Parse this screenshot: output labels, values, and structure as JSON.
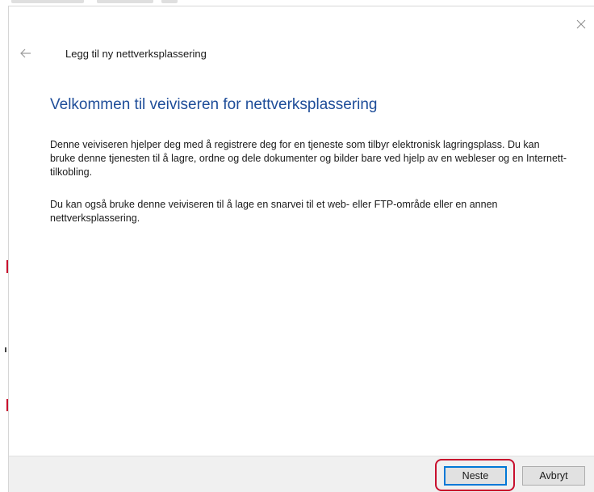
{
  "dialog": {
    "wizard_title": "Legg til ny nettverksplassering",
    "heading": "Velkommen til veiviseren for nettverksplassering",
    "paragraph1": "Denne veiviseren hjelper deg med å registrere deg for en tjeneste som tilbyr elektronisk lagringsplass. Du kan bruke denne tjenesten til å lagre, ordne og dele dokumenter og bilder bare ved hjelp av en webleser og en Internett-tilkobling.",
    "paragraph2": "Du kan også bruke denne veiviseren til å lage en snarvei til et web- eller FTP-område eller en annen nettverksplassering."
  },
  "footer": {
    "next_label": "Neste",
    "cancel_label": "Avbryt"
  },
  "icons": {
    "close": "close-icon",
    "back": "back-arrow-icon"
  },
  "colors": {
    "heading": "#1e4d99",
    "highlight": "#c8102e",
    "focus_border": "#0078d7",
    "footer_bg": "#f0f0f0"
  }
}
